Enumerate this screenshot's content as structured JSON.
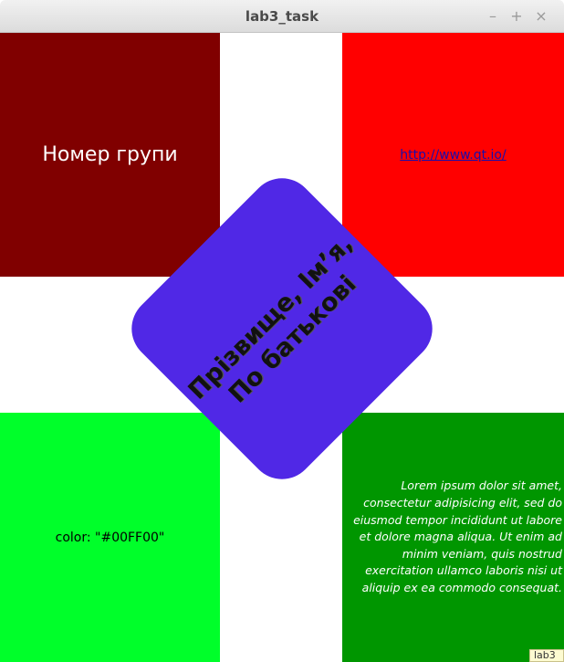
{
  "window": {
    "title": "lab3_task",
    "controls": {
      "minimize": "–",
      "maximize": "+",
      "close": "×"
    }
  },
  "tiles": {
    "top_left": {
      "text": "Номер групи",
      "color": "#800000"
    },
    "top_right": {
      "link_text": "http://www.qt.io/",
      "color": "#ff0000"
    },
    "bottom_left": {
      "text": "color: \"#00FF00\"",
      "color": "#00ff2a"
    },
    "bottom_right": {
      "color": "#009600",
      "lines": [
        "Lorem ipsum dolor sit amet,",
        "consectetur adipisicing elit, sed do",
        "eiusmod tempor incididunt ut labore",
        "et dolore magna aliqua. Ut enim ad",
        "minim veniam, quis nostrud",
        "exercitation ullamco laboris nisi ut",
        "aliquip ex ea commodo consequat."
      ]
    }
  },
  "diamond": {
    "color": "#5028e6",
    "line1": "Прізвище, Ім’я,",
    "line2": "По батькові"
  },
  "corner_tab": {
    "text": "lab3"
  }
}
